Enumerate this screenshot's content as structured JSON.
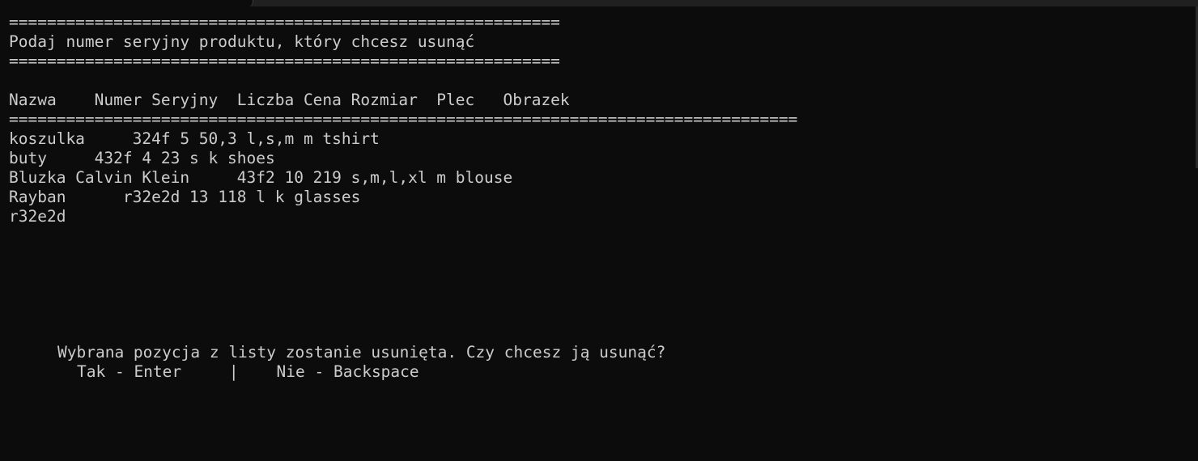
{
  "terminal": {
    "separator_short": "==========================================================",
    "prompt": "Podaj numer seryjny produktu, który chcesz usunąć",
    "separator_short_2": "==========================================================",
    "table_header": "Nazwa    Numer Seryjny  Liczba Cena Rozmiar  Plec   Obrazek",
    "separator_long": "===================================================================================",
    "rows": [
      "koszulka     324f 5 50,3 l,s,m m tshirt",
      "buty     432f 4 23 s k shoes",
      "Bluzka Calvin Klein     43f2 10 219 s,m,l,xl m blouse",
      "Rayban      r32e2d 13 118 l k glasses"
    ],
    "input_value": "r32e2d",
    "confirm_question": "Wybrana pozycja z listy zostanie usunięta. Czy chcesz ją usunąć?",
    "confirm_options": "Tak - Enter     |    Nie - Backspace"
  },
  "colors": {
    "background": "#0c0c0c",
    "text": "#cccccc"
  }
}
